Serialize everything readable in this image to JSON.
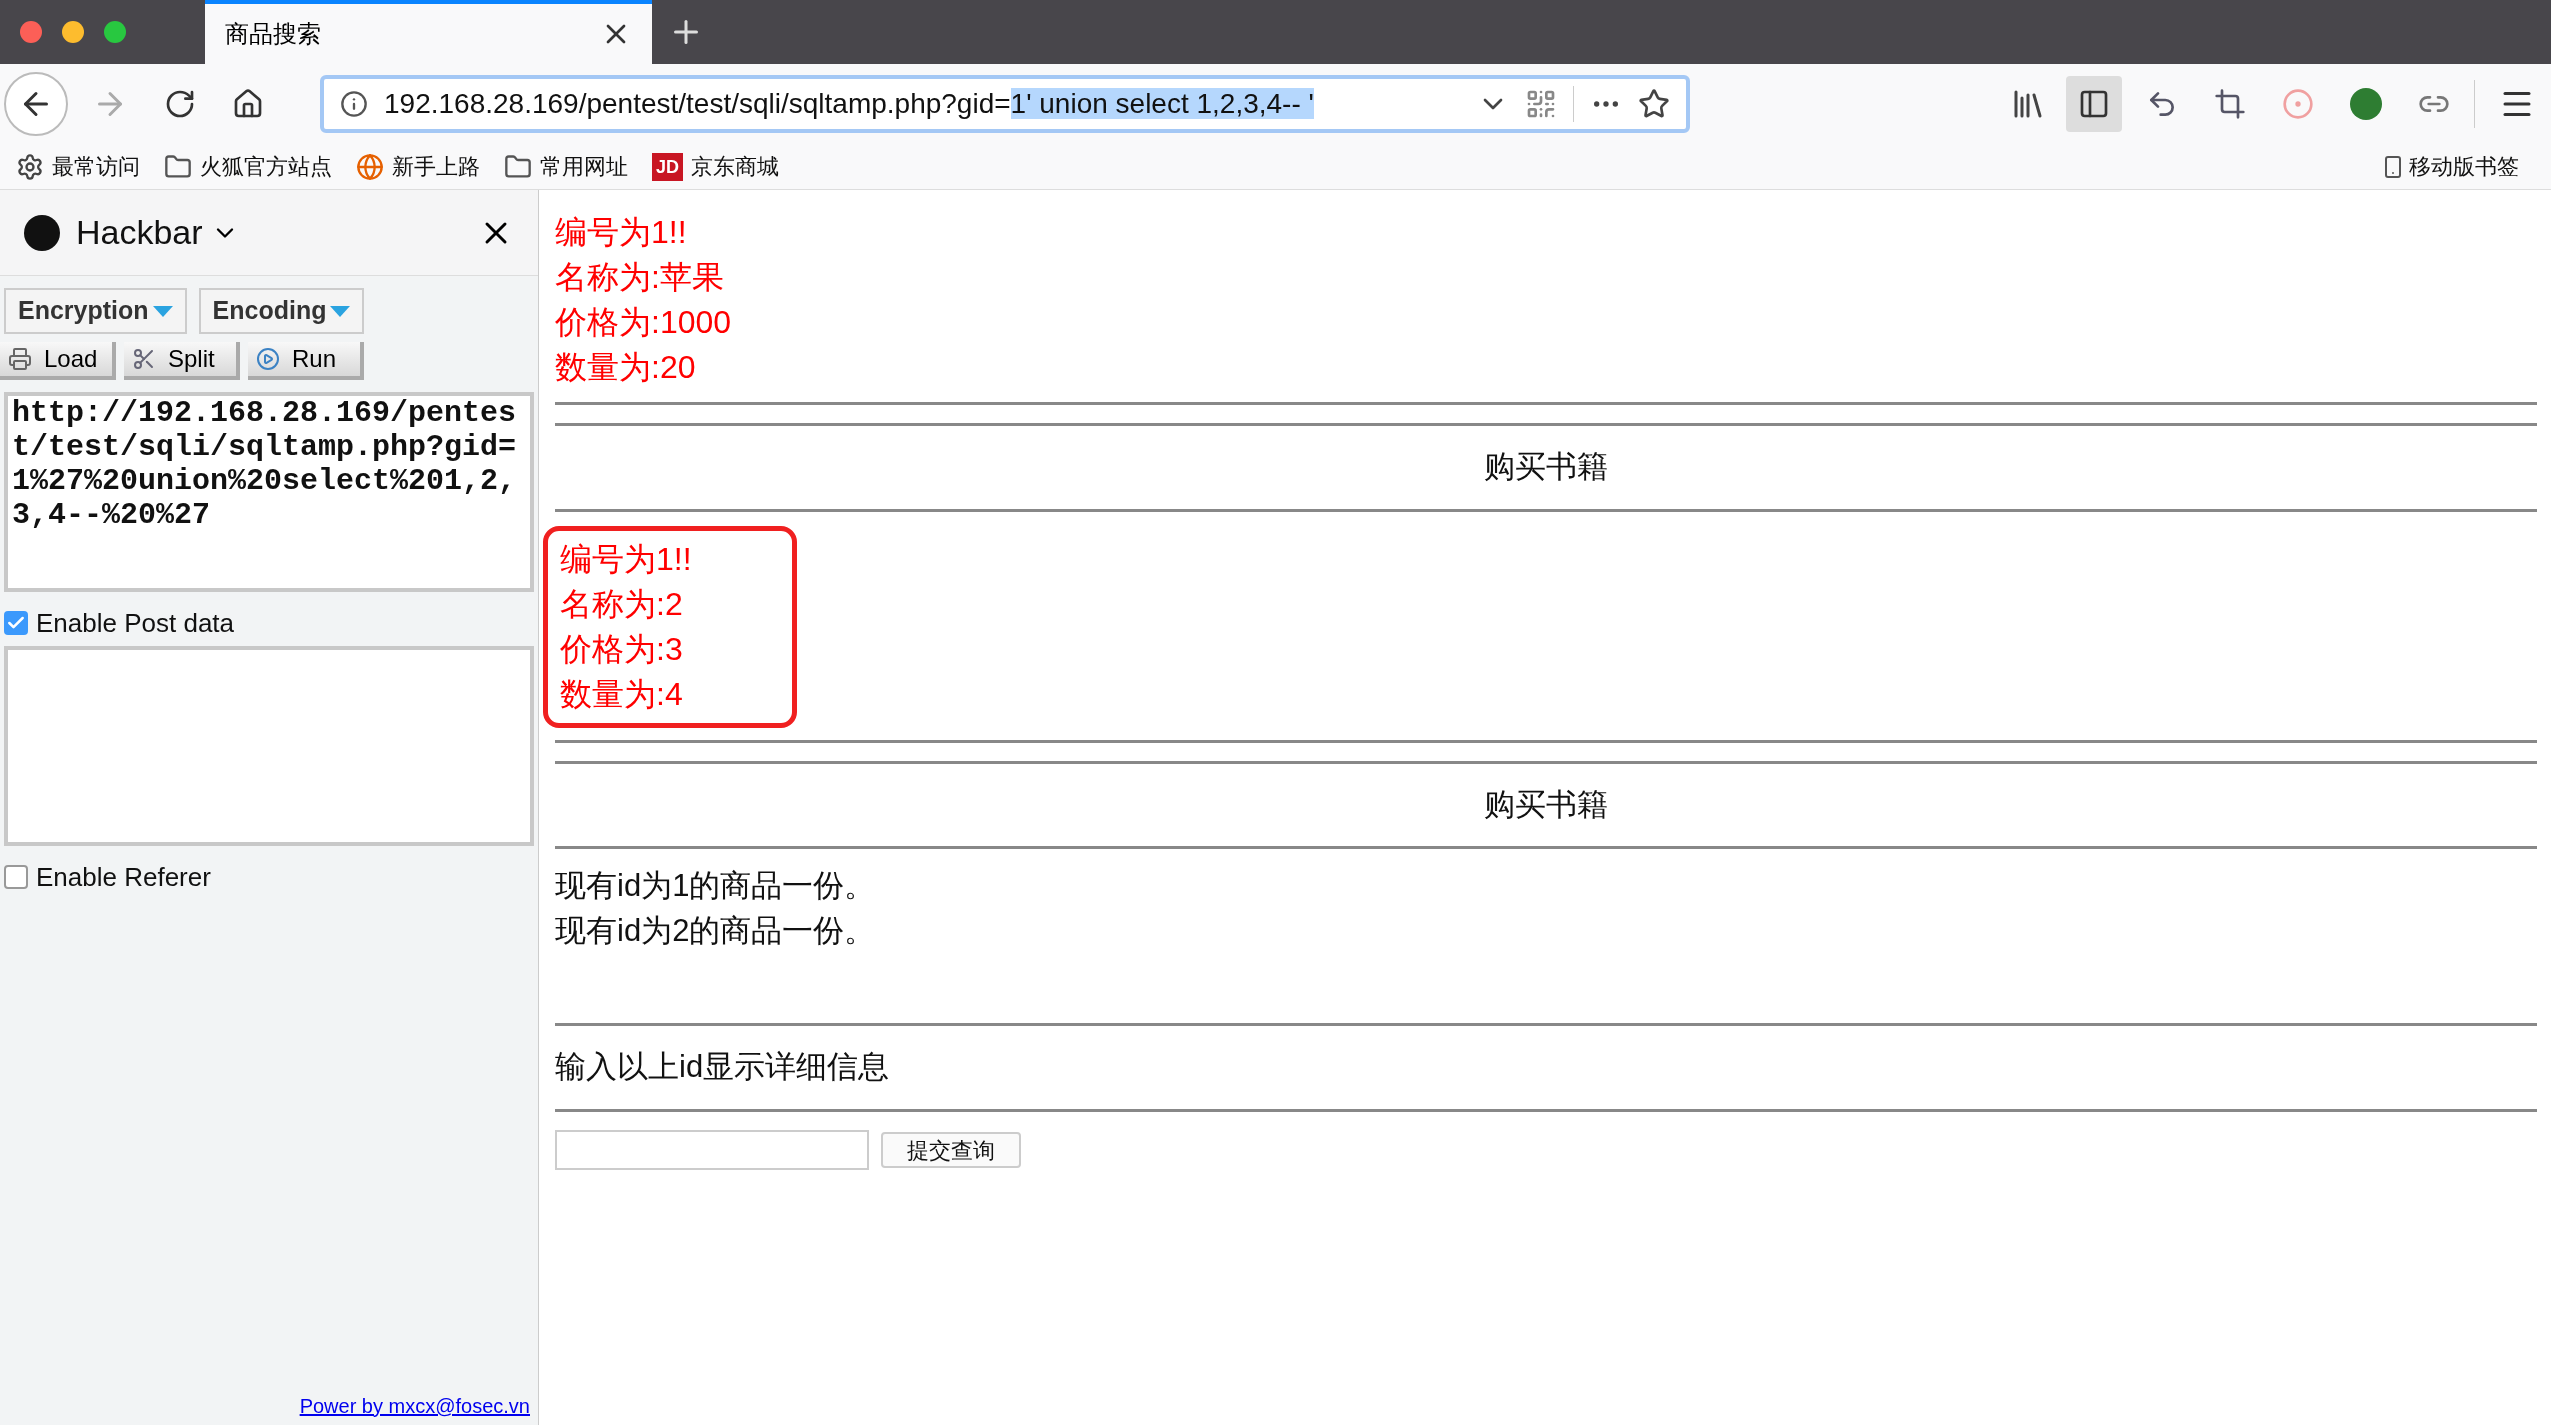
{
  "browser": {
    "tabs": [
      {
        "title": "商品搜索",
        "selected": true
      }
    ],
    "address": {
      "text": "192.168.28.169/pentest/test/sqli/sqltamp.php?gid=",
      "selected_text": "1' union select 1,2,3,4-- '"
    },
    "bookmarks": [
      {
        "label": "最常访问",
        "kind": "gear"
      },
      {
        "label": "火狐官方站点",
        "kind": "folder"
      },
      {
        "label": "新手上路",
        "kind": "globe"
      },
      {
        "label": "常用网址",
        "kind": "folder"
      },
      {
        "label": "京东商城",
        "kind": "jd",
        "icon_text": "JD"
      }
    ],
    "mobile_bookmarks": "移动版书签"
  },
  "hackbar": {
    "title": "Hackbar",
    "menus": [
      "Encryption",
      "Encoding"
    ],
    "actions": [
      "Load",
      "Split",
      "Run"
    ],
    "url": "http://192.168.28.169/pentest/test/sqli/sqltamp.php?gid=1%27%20union%20select%201,2,3,4--%20%27",
    "options": [
      {
        "label": "Enable Post data",
        "checked": true
      },
      {
        "label": "Enable Referer",
        "checked": false
      }
    ],
    "footer": "Power by mxcx@fosec.vn"
  },
  "page": {
    "records": [
      {
        "lines": [
          "编号为1!!",
          "名称为:苹果",
          "价格为:1000",
          "数量为:20"
        ],
        "highlighted": false,
        "heading": "购买书籍"
      },
      {
        "lines": [
          "编号为1!!",
          "名称为:2",
          "价格为:3",
          "数量为:4"
        ],
        "highlighted": true,
        "heading": "购买书籍"
      }
    ],
    "owned": [
      "现有id为1的商品一份。",
      "现有id为2的商品一份。"
    ],
    "prompt": "输入以上id显示详细信息",
    "submit": "提交查询"
  }
}
